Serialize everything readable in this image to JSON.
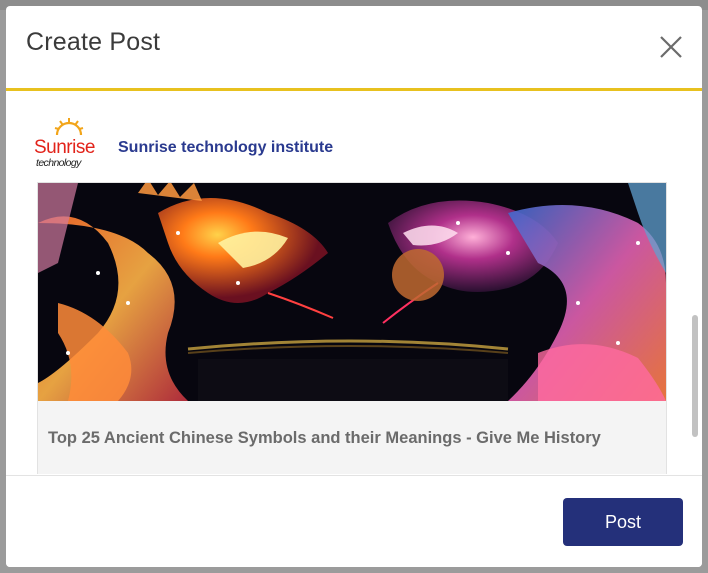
{
  "modal": {
    "title": "Create Post",
    "close_icon": "close-icon"
  },
  "author": {
    "logo_text": "Sunrise",
    "logo_subtext": "technology",
    "name": "Sunrise technology institute"
  },
  "preview": {
    "image": "dragon-lanterns-image",
    "title": "Top 25 Ancient Chinese Symbols and their Meanings - Give Me History"
  },
  "footer": {
    "post_label": "Post"
  },
  "colors": {
    "accent_rule": "#e8c11f",
    "primary_button": "#24307a",
    "author_link": "#2a3a8f",
    "logo_red": "#e2231a"
  }
}
